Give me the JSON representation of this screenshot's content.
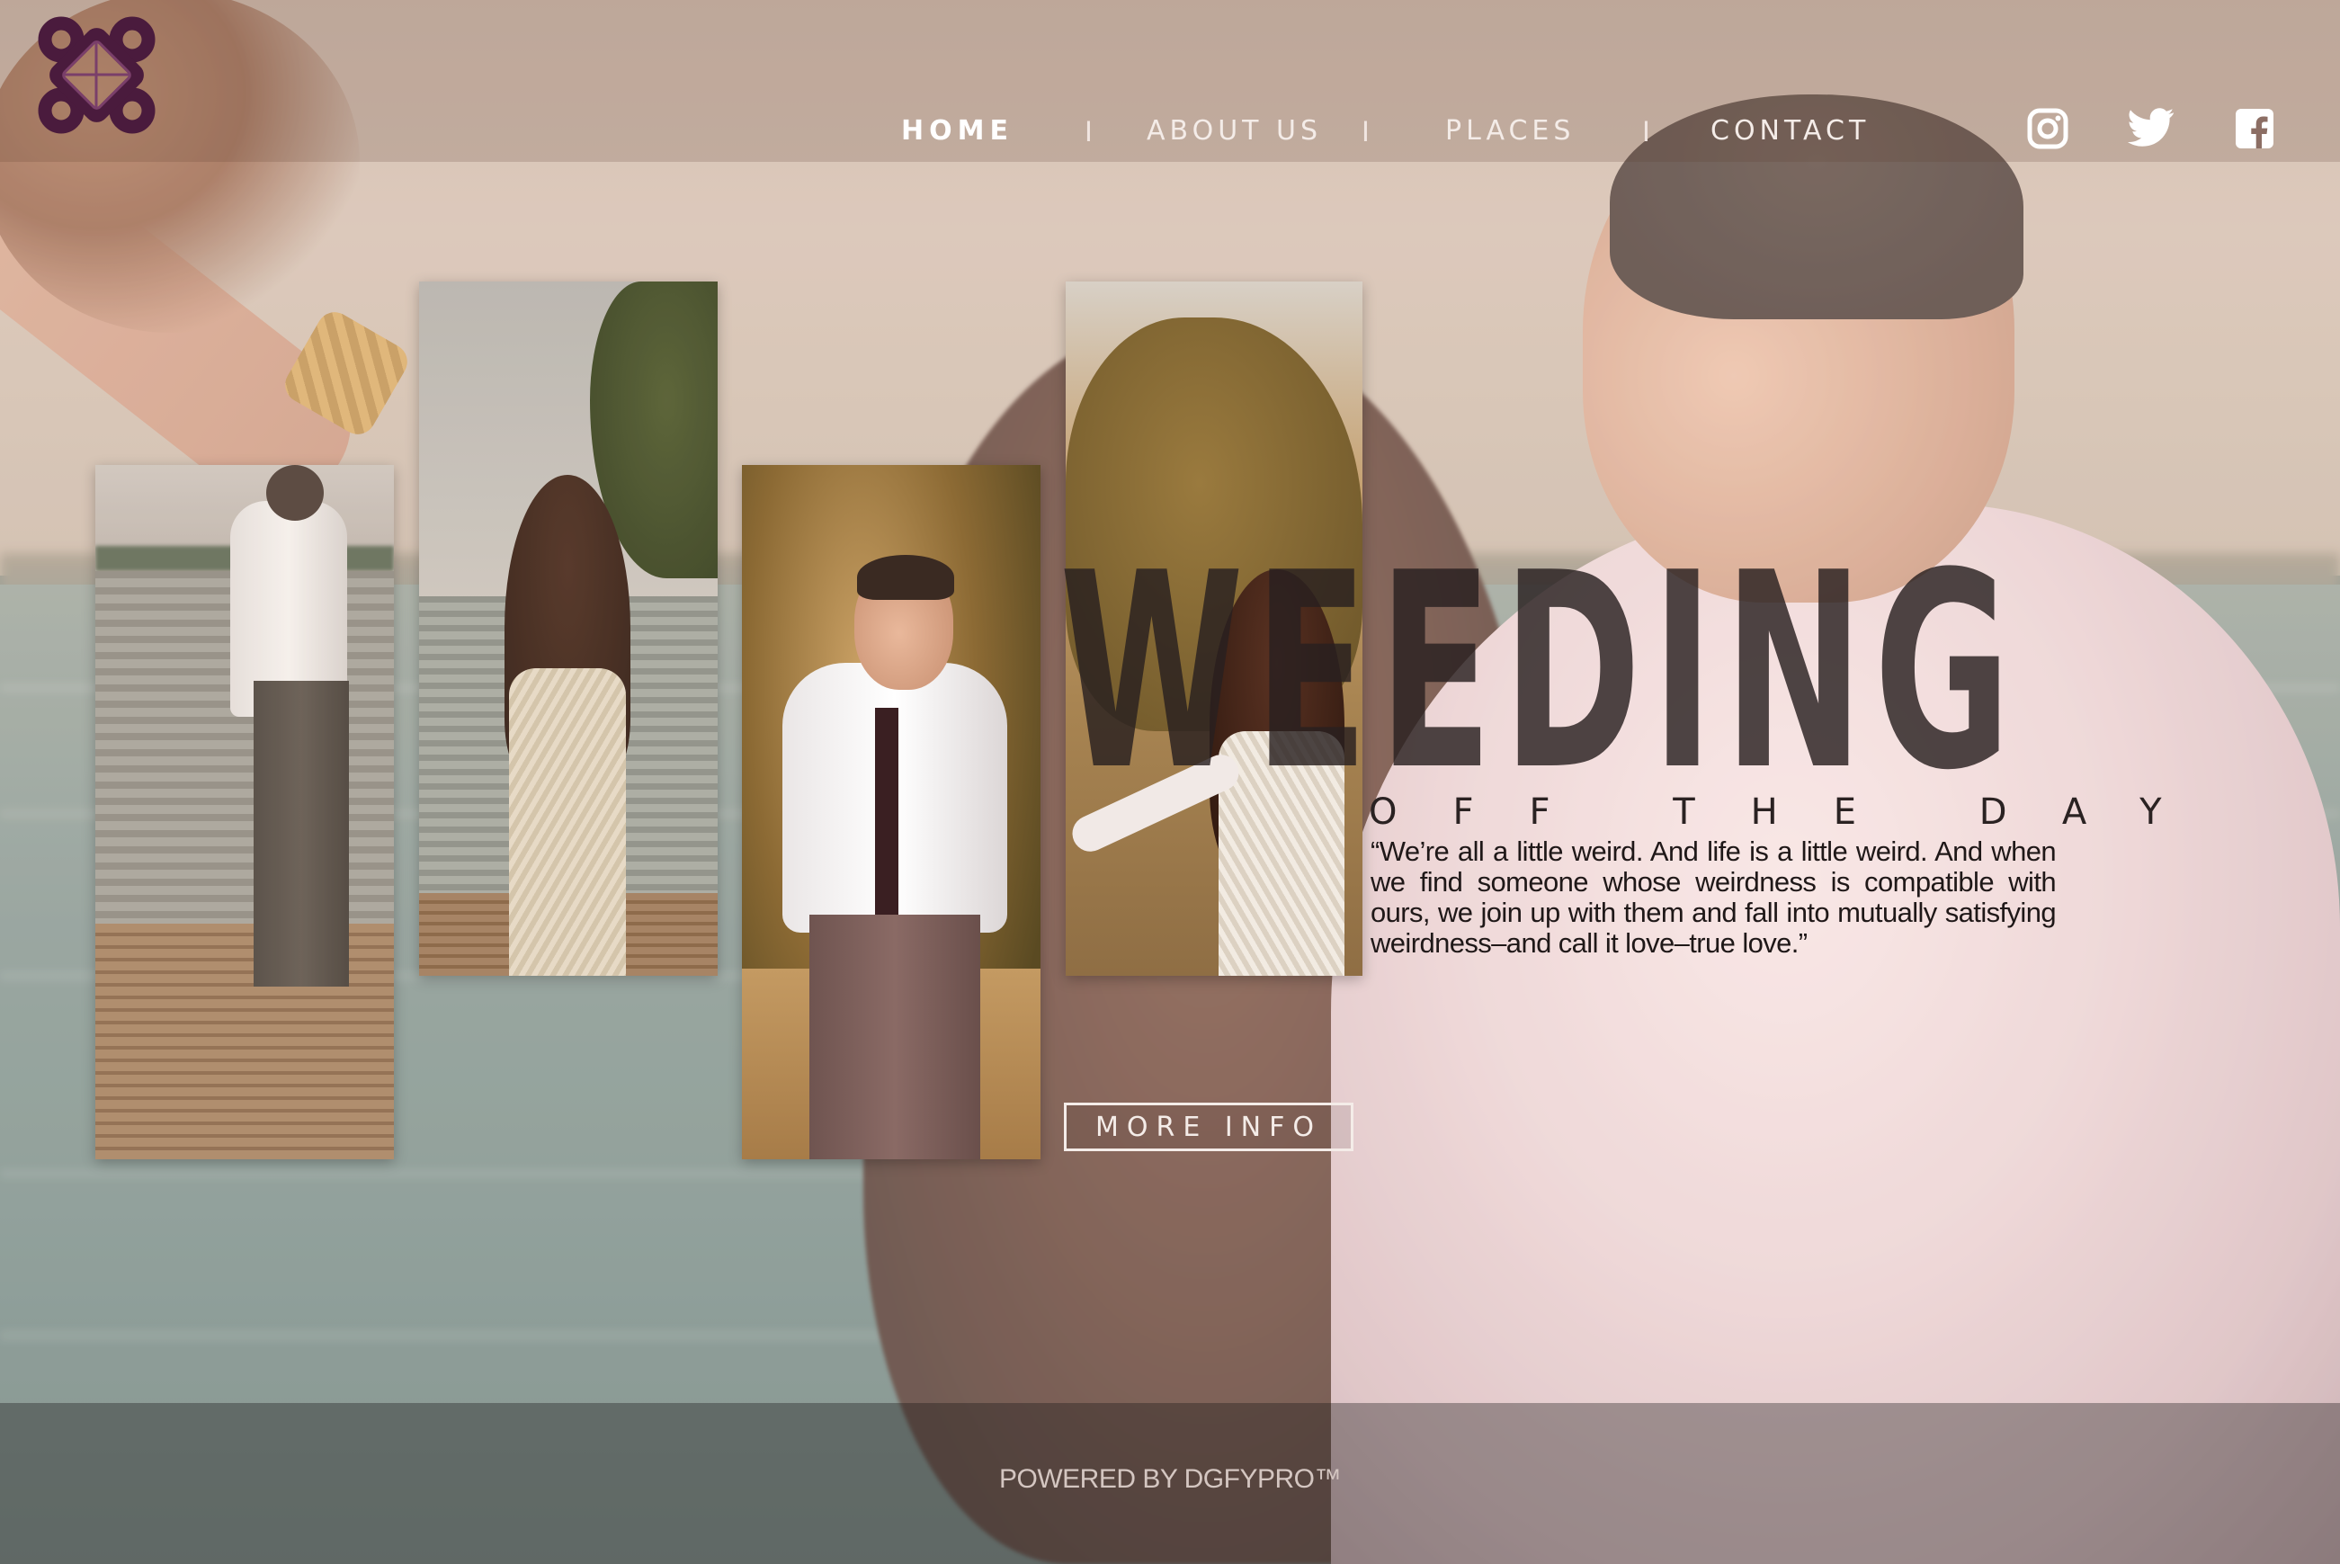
{
  "brand": {
    "logo_icon": "celtic-knot-logo-icon",
    "logo_color": "#4a1b3d"
  },
  "nav": {
    "items": [
      {
        "label": "HOME",
        "active": true
      },
      {
        "label": "ABOUT US",
        "active": false
      },
      {
        "label": "PLACES",
        "active": false
      },
      {
        "label": "CONTACT",
        "active": false
      }
    ],
    "separator": "I"
  },
  "social": [
    {
      "icon": "instagram-icon"
    },
    {
      "icon": "twitter-icon"
    },
    {
      "icon": "facebook-icon"
    }
  ],
  "hero": {
    "title": "WEEDING",
    "subtitle": "OFF THE DAY",
    "quote": "“We’re all a little weird. And life is a little weird. And when we find someone whose weirdness is compatible with ours, we join up with them and fall into mutually satisfying weirdness–and call it love–true love.”",
    "button_label": "MORE INFO"
  },
  "cards": [
    {
      "icon": "groom-on-pier-photo"
    },
    {
      "icon": "bride-by-lake-photo"
    },
    {
      "icon": "groom-smiling-photo"
    },
    {
      "icon": "bride-holding-hands-photo"
    }
  ],
  "footer": {
    "text": "POWERED BY DGFYPRO™"
  },
  "colors": {
    "text_light": "#f4ece8",
    "title_dark": "#282020",
    "accent_plum": "#4a1b3d"
  }
}
